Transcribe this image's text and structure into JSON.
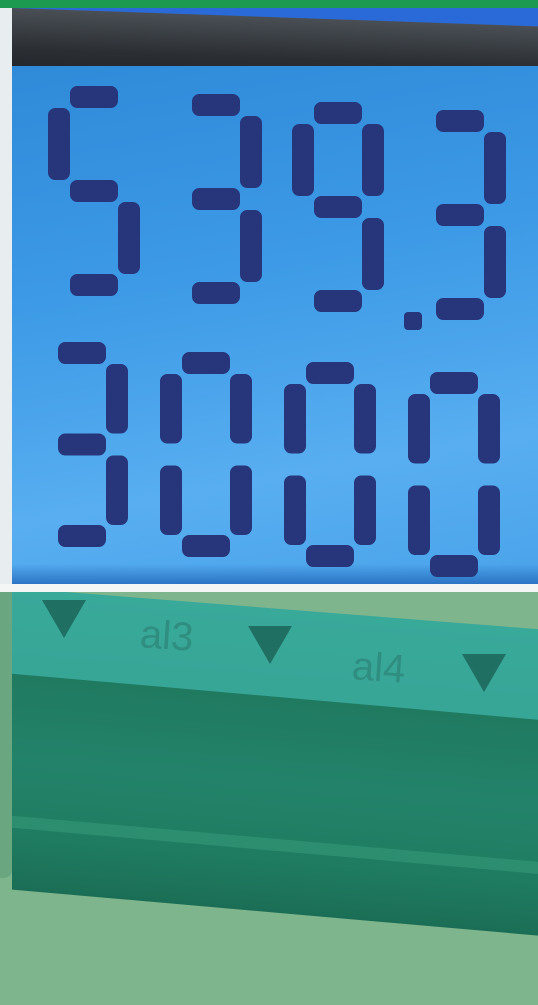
{
  "display": {
    "upper_readout": "5393",
    "lower_readout": "3000"
  },
  "alarm_labels": [
    "al3",
    "al4"
  ],
  "colors": {
    "accent_bar": "#1b9a50",
    "lcd_background": "#3d9ae6",
    "lcd_segment": "#27357a",
    "housing": "#23836a",
    "label_strip": "#39a99a",
    "page_background": "#7fb58c"
  },
  "icons": [
    "alarm-indicator-triangle-icon"
  ]
}
